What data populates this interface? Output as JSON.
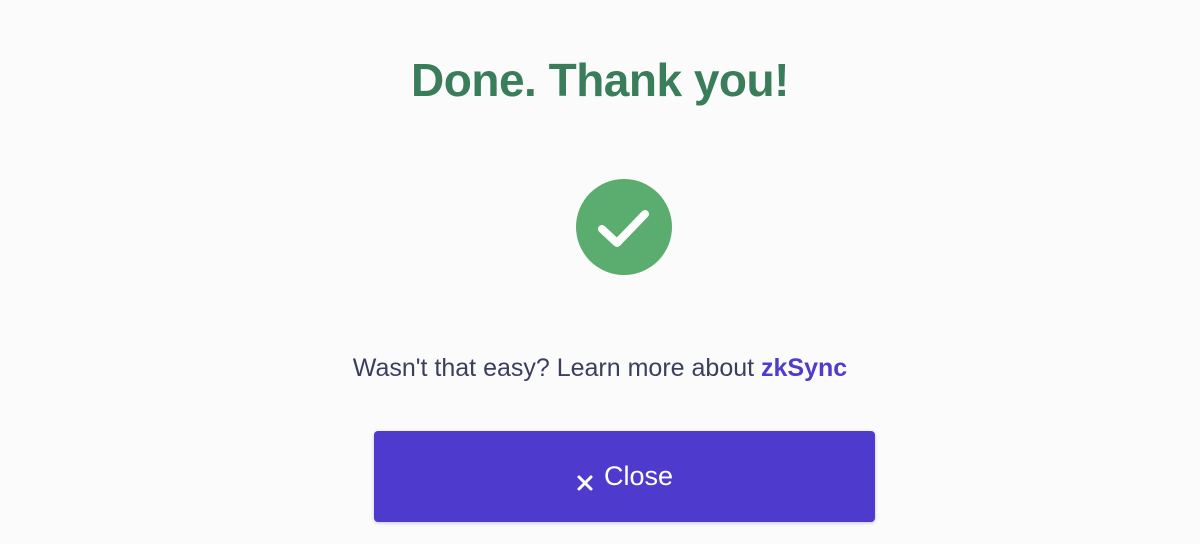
{
  "header": {
    "title": "Done. Thank you!"
  },
  "status": {
    "icon": "check-circle-icon",
    "color": "#5aad6e"
  },
  "message": {
    "text": "Wasn't that easy? Learn more about ",
    "link_label": "zkSync",
    "link_color": "#4f3ccc"
  },
  "actions": {
    "close_label": "Close",
    "close_icon": "close-icon",
    "button_color": "#4e3bcd"
  },
  "theme": {
    "title_color": "#3a7d5a",
    "text_color": "#3b3f5c",
    "background": "#fbfbfc"
  }
}
